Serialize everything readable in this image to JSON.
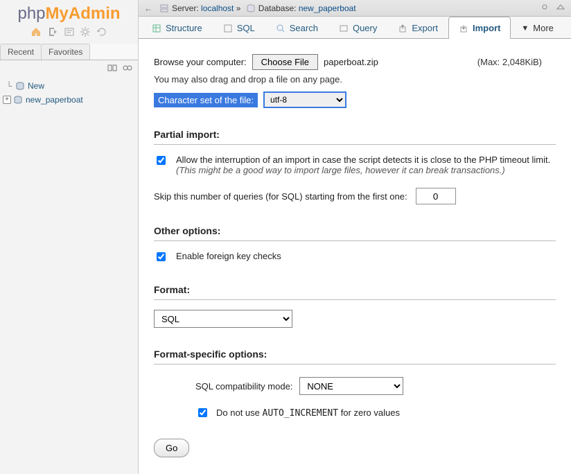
{
  "logo": {
    "p1": "php",
    "p2": "MyAdmin",
    "p3": ""
  },
  "sidebar": {
    "mini_tabs": [
      "Recent",
      "Favorites"
    ],
    "items": [
      {
        "label": "New"
      },
      {
        "label": "new_paperboat"
      }
    ]
  },
  "breadcrumb": {
    "server_label": "Server:",
    "server_value": "localhost",
    "sep": "»",
    "db_label": "Database:",
    "db_value": "new_paperboat"
  },
  "tabs": [
    {
      "label": "Structure"
    },
    {
      "label": "SQL"
    },
    {
      "label": "Search"
    },
    {
      "label": "Query"
    },
    {
      "label": "Export"
    },
    {
      "label": "Import",
      "active": true
    },
    {
      "label": "More",
      "more": true
    }
  ],
  "browse": {
    "label": "Browse your computer:",
    "button": "Choose File",
    "filename": "paperboat.zip",
    "max": "(Max: 2,048KiB)",
    "drag_note": "You may also drag and drop a file on any page."
  },
  "charset": {
    "label": "Character set of the file:",
    "value": "utf-8"
  },
  "partial": {
    "head": "Partial import:",
    "allow_text": "Allow the interruption of an import in case the script detects it is close to the PHP timeout limit.",
    "allow_hint": "(This might be a good way to import large files, however it can break transactions.)",
    "skip_label": "Skip this number of queries (for SQL) starting from the first one:",
    "skip_value": "0"
  },
  "other": {
    "head": "Other options:",
    "fk_label": "Enable foreign key checks"
  },
  "format": {
    "head": "Format:",
    "value": "SQL"
  },
  "specific": {
    "head": "Format-specific options:",
    "compat_label": "SQL compatibility mode:",
    "compat_value": "NONE",
    "ai_label_pre": "Do not use ",
    "ai_code": "AUTO_INCREMENT",
    "ai_label_post": " for zero values"
  },
  "go": "Go"
}
